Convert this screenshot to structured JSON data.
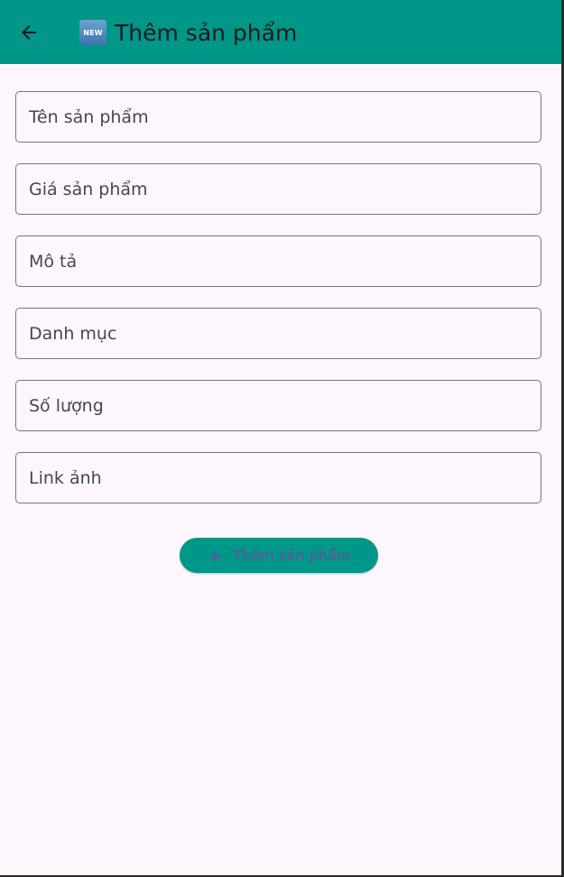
{
  "app_bar": {
    "back_icon": "arrow-back-icon",
    "badge_icon": "new-badge-icon",
    "badge_text": "NEW",
    "title": "Thêm sản phẩm",
    "background": "#009688"
  },
  "form": {
    "fields": [
      {
        "placeholder": "Tên sản phẩm"
      },
      {
        "placeholder": "Giá sản phẩm"
      },
      {
        "placeholder": "Mô tả"
      },
      {
        "placeholder": "Danh mục"
      },
      {
        "placeholder": "Số lượng"
      },
      {
        "placeholder": "Link ảnh"
      }
    ],
    "submit": {
      "icon": "plus-icon",
      "icon_glyph": "+",
      "label": "Thêm sản phẩm",
      "background": "#009688",
      "text_color": "#6750a4"
    }
  },
  "colors": {
    "background": "#fdf7fd",
    "border": "#79747e"
  }
}
